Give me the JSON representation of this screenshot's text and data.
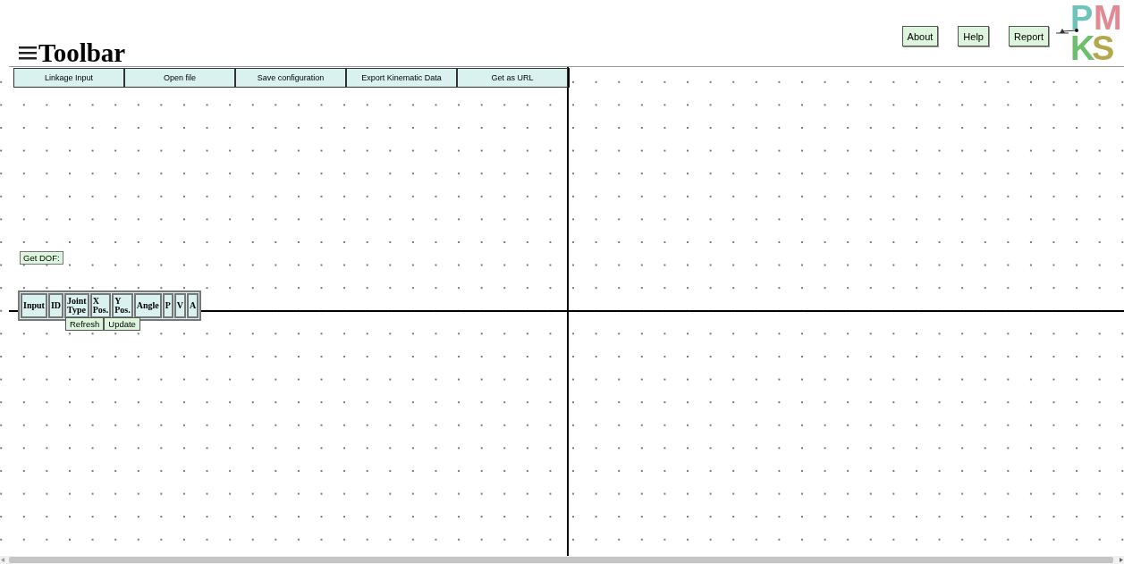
{
  "header": {
    "title": "Toolbar",
    "buttons": [
      "About",
      "Help",
      "Report"
    ],
    "logo_letters": [
      {
        "text": "P",
        "color": "#6cc4bb"
      },
      {
        "text": "M",
        "color": "#e08a94"
      },
      {
        "text": "K",
        "color": "#6cbf6c"
      },
      {
        "text": "S",
        "color": "#b5a84c"
      }
    ]
  },
  "toolbar": {
    "buttons": [
      "Linkage Input",
      "Open file",
      "Save configuration",
      "Export Kinematic Data",
      "Get as URL"
    ]
  },
  "dof_button": "Get DOF:",
  "joint_table": {
    "columns": [
      "Input",
      "ID",
      "Joint Type",
      "X Pos.",
      "Y Pos.",
      "Angle",
      "P",
      "V",
      "A"
    ],
    "buttons": [
      "Refresh",
      "Update"
    ]
  }
}
